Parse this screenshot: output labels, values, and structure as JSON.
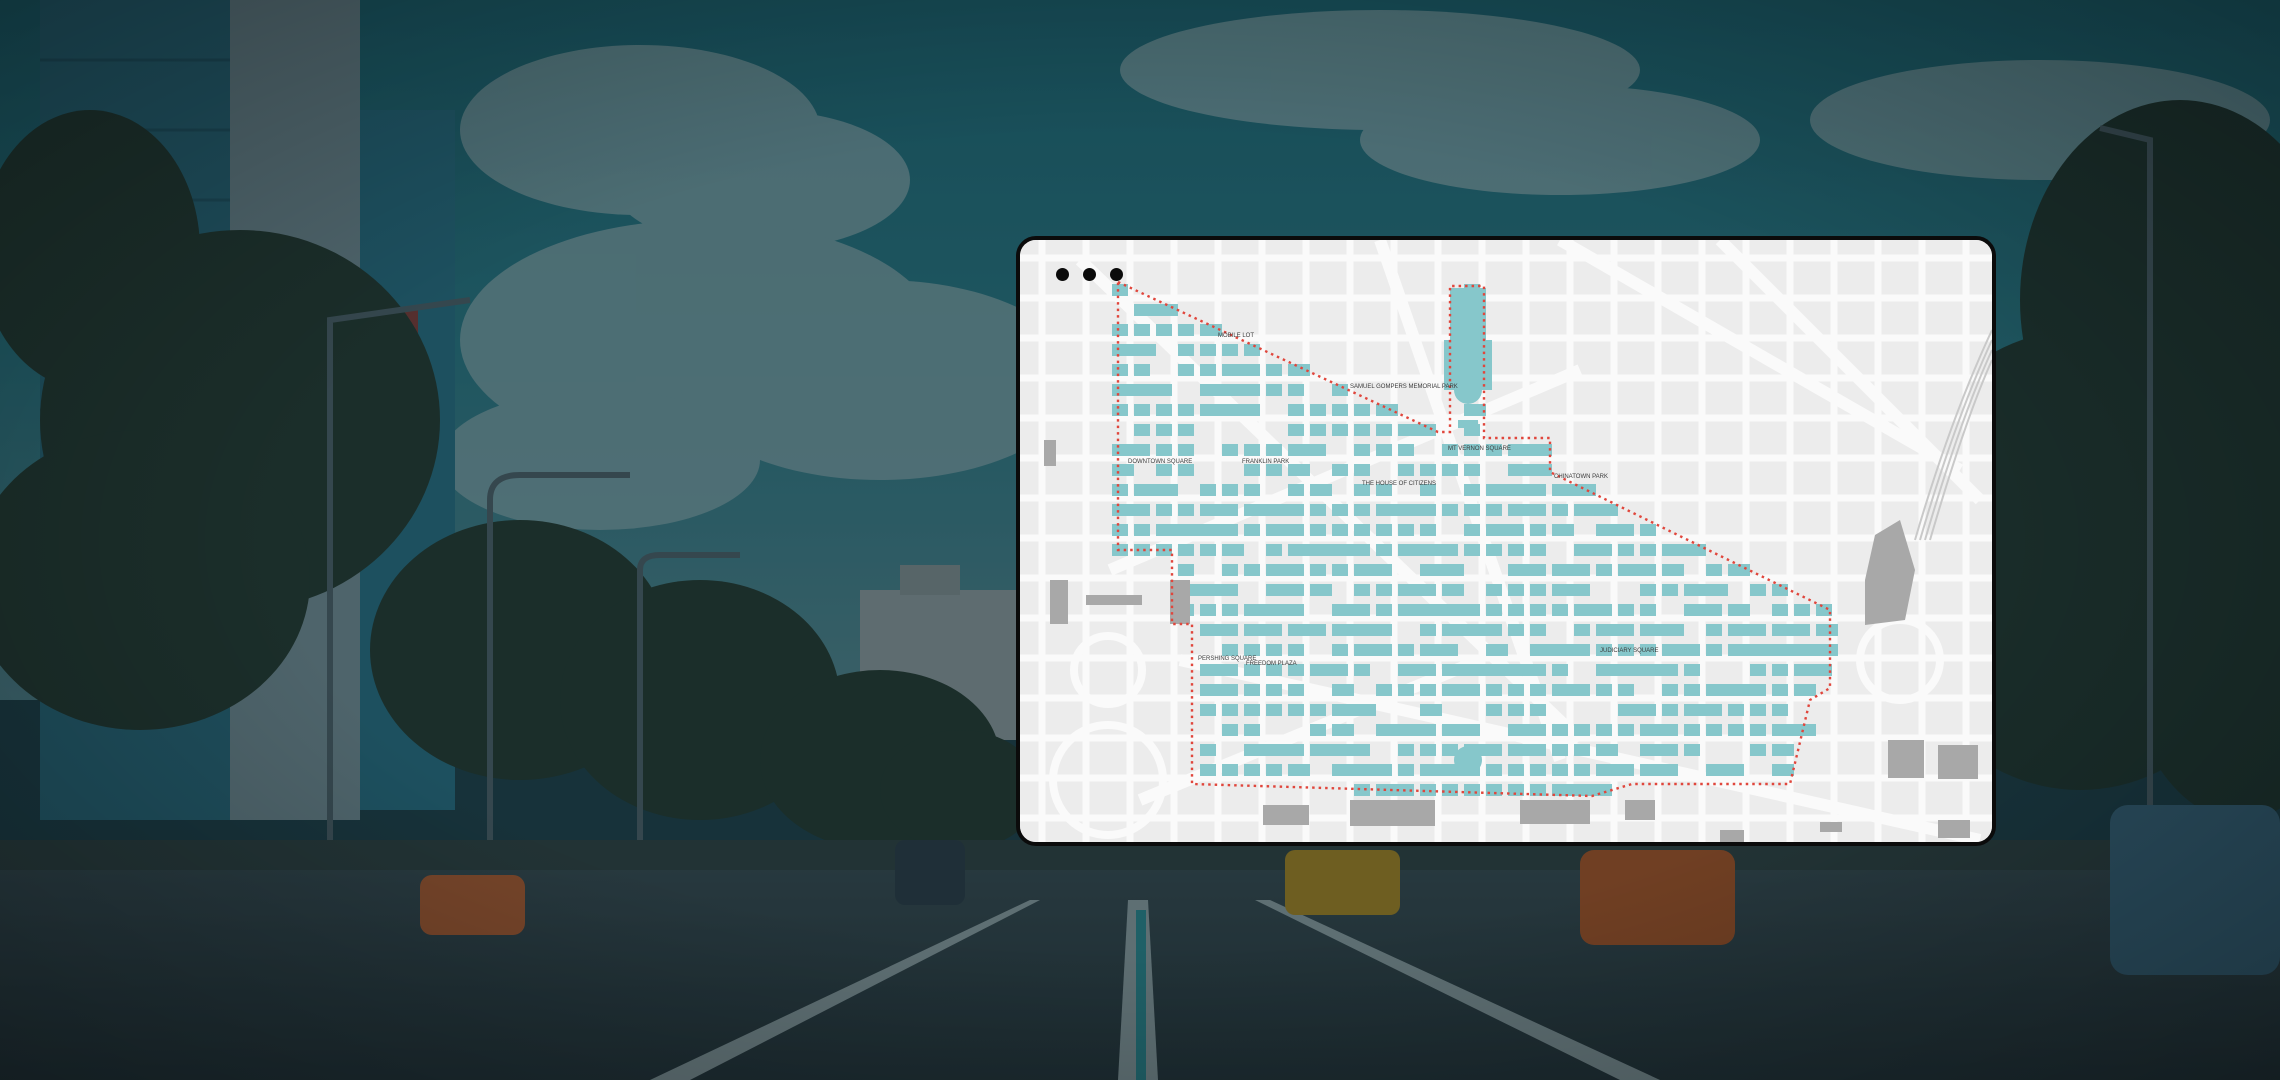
{
  "window": {
    "title_dots": 3
  },
  "colors": {
    "map_background": "#ececec",
    "road": "#fafafa",
    "block": "#e3e3e3",
    "district_block": "#86c7cb",
    "landmark": "#a8a8a8",
    "boundary": "#e0463c",
    "background_overlay": "#1f3f47"
  },
  "map": {
    "labels": [
      {
        "id": "mobile-lot",
        "text": "MOBILE LOT"
      },
      {
        "id": "memorial",
        "text": "SAMUEL GOMPERS MEMORIAL PARK"
      },
      {
        "id": "mt-vernon",
        "text": "MT VERNON SQUARE"
      },
      {
        "id": "chinatown-park",
        "text": "CHINATOWN PARK"
      },
      {
        "id": "downtown-square",
        "text": "DOWNTOWN SQUARE"
      },
      {
        "id": "franklin-park",
        "text": "FRANKLIN PARK"
      },
      {
        "id": "house-citizens",
        "text": "THE HOUSE OF CITIZENS"
      },
      {
        "id": "pershing",
        "text": "PERSHING SQUARE"
      },
      {
        "id": "freedom-plaza",
        "text": "FREEDOM PLAZA"
      },
      {
        "id": "judiciary",
        "text": "JUDICIARY SQUARE"
      }
    ]
  },
  "icons": {
    "background": "city-street-photo",
    "window_controls": "window-dots-icon"
  }
}
